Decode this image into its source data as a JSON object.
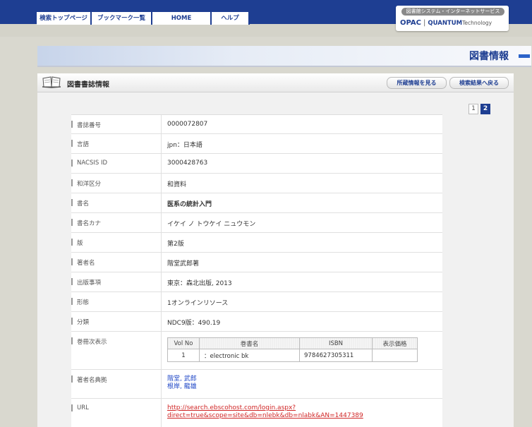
{
  "nav": {
    "tabs": [
      {
        "label": "検索トップページ"
      },
      {
        "label": "ブックマーク一覧"
      },
      {
        "label": "HOME"
      },
      {
        "label": "ヘルプ"
      }
    ]
  },
  "brand": {
    "subtitle": "図書館システム・インターネットサービス",
    "opac": "OPAC",
    "sep": "|",
    "quantum": "QUANTUM",
    "technology": "Technology"
  },
  "banner": {
    "title": "図書情報"
  },
  "panel": {
    "title": "図書書誌情報",
    "holdings_button": "所蔵情報を見る",
    "back_button": "検索結果へ戻る"
  },
  "pager": {
    "pages": [
      "1",
      "2"
    ],
    "current": "2"
  },
  "record": {
    "rows": [
      {
        "label": "書誌番号",
        "value": "0000072807"
      },
      {
        "label": "言語",
        "value": "jpn：日本語"
      },
      {
        "label": "NACSIS ID",
        "value": "3000428763"
      },
      {
        "label": "和洋区分",
        "value": "和資料"
      },
      {
        "label": "書名",
        "value": "医系の統計入門"
      },
      {
        "label": "書名カナ",
        "value": "イケイ ノ トウケイ ニュウモン"
      },
      {
        "label": "版",
        "value": "第2版"
      },
      {
        "label": "著者名",
        "value": "階堂武郎著"
      },
      {
        "label": "出版事項",
        "value": "東京：森北出版, 2013"
      },
      {
        "label": "形態",
        "value": "1オンラインリソース"
      },
      {
        "label": "分類",
        "value": "NDC9版：490.19"
      }
    ],
    "volume": {
      "label": "巻冊次表示",
      "headers": [
        "Vol No",
        "巻書名",
        "ISBN",
        "表示価格"
      ],
      "rows": [
        [
          "1",
          "：electronic bk",
          "9784627305311",
          ""
        ]
      ]
    },
    "authority": {
      "label": "著者名典拠",
      "links": [
        "階堂, 武郎",
        "根岸, 龍雄"
      ]
    },
    "url": {
      "label": "URL",
      "line1": "http://search.ebscohost.com/login.aspx?",
      "line2": "direct=true&scope=site&db=nlebk&db=nlabk&AN=1447389"
    }
  }
}
